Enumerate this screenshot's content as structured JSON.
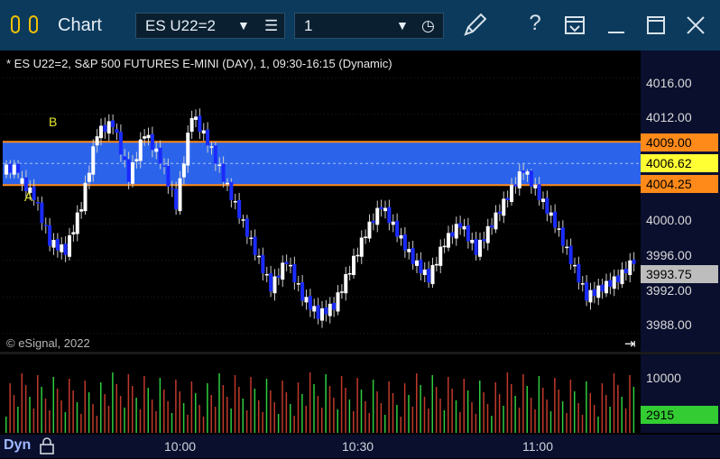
{
  "window": {
    "title": "Chart",
    "symbol": "ES U22=2",
    "interval": "1",
    "colors": {
      "titlebar": "#0b3a5c",
      "logo": "#f2c200"
    }
  },
  "chart": {
    "header": "* ES U22=2, S&P 500 FUTURES E-MINI (DAY), 1, 09:30-16:15 (Dynamic)",
    "copyright": "© eSignal, 2022",
    "markers": [
      "A",
      "B"
    ],
    "band": {
      "upper": "4009.00",
      "mid": "4006.62",
      "lower": "4004.25",
      "color": "#2f6cff",
      "edge_color": "#ff8a1a"
    },
    "last_price": "3993.75",
    "price_ticks": [
      "4016.00",
      "4012.00",
      "4000.00",
      "3996.00",
      "3992.00",
      "3988.00"
    ],
    "volume": {
      "tick": "10000",
      "last": "2915"
    },
    "time_ticks": [
      "10:00",
      "10:30",
      "11:00"
    ],
    "mode": "Dyn"
  },
  "chart_data": {
    "type": "candlestick",
    "price_axis": [
      3986,
      4019
    ],
    "candles_approx": [
      [
        4006,
        4007,
        4005,
        4006
      ],
      [
        4005,
        4006,
        4002,
        4003
      ],
      [
        4003,
        4003,
        3997,
        3998
      ],
      [
        3998,
        3999,
        3995,
        3997
      ],
      [
        3997,
        4003,
        3996,
        4002
      ],
      [
        4002,
        4012,
        4001,
        4010
      ],
      [
        4010,
        4012,
        4006,
        4011
      ],
      [
        4011,
        4011,
        4003,
        4005
      ],
      [
        4005,
        4012,
        4004,
        4010
      ],
      [
        4010,
        4011,
        4006,
        4007
      ],
      [
        4007,
        4008,
        4001,
        4002
      ],
      [
        4002,
        4013,
        4001,
        4012
      ],
      [
        4012,
        4016,
        4005,
        4009
      ],
      [
        4009,
        4009,
        4004,
        4005
      ],
      [
        4005,
        4005,
        4000,
        4001
      ],
      [
        4001,
        4001,
        3996,
        3997
      ],
      [
        3997,
        3998,
        3992,
        3993
      ],
      [
        3993,
        3997,
        3991,
        3996
      ],
      [
        3996,
        3997,
        3991,
        3992
      ],
      [
        3992,
        3993,
        3989,
        3990
      ],
      [
        3990,
        3992,
        3988,
        3991
      ],
      [
        3991,
        3996,
        3990,
        3995
      ],
      [
        3995,
        4000,
        3994,
        3999
      ],
      [
        3999,
        4003,
        3998,
        4002
      ],
      [
        4002,
        4003,
        3998,
        3999
      ],
      [
        3999,
        4000,
        3995,
        3996
      ],
      [
        3996,
        3997,
        3993,
        3994
      ],
      [
        3994,
        3999,
        3993,
        3998
      ],
      [
        3998,
        4001,
        3997,
        4000
      ],
      [
        4000,
        4001,
        3996,
        3997
      ],
      [
        3997,
        4001,
        3996,
        4000
      ],
      [
        4000,
        4004,
        3999,
        4003
      ],
      [
        4003,
        4007,
        4002,
        4006
      ],
      [
        4006,
        4006,
        4002,
        4003
      ],
      [
        4003,
        4004,
        3999,
        4000
      ],
      [
        4000,
        4001,
        3995,
        3996
      ],
      [
        3996,
        3997,
        3991,
        3992
      ],
      [
        3992,
        3994,
        3990,
        3993
      ],
      [
        3993,
        3995,
        3992,
        3994
      ],
      [
        3994,
        3997,
        3993,
        3996
      ]
    ]
  }
}
